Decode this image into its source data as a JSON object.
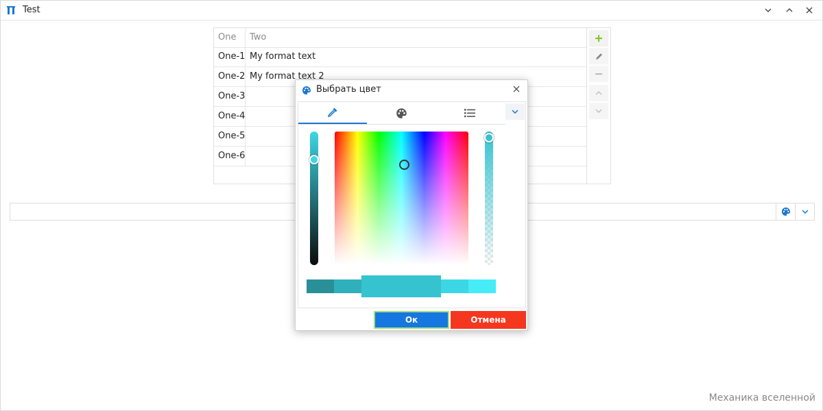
{
  "window": {
    "title": "Test"
  },
  "table": {
    "headers": [
      "One",
      "Two"
    ],
    "rows": [
      [
        "One-1",
        "My format text"
      ],
      [
        "One-2",
        "My format text 2"
      ],
      [
        "One-3",
        ""
      ],
      [
        "One-4",
        ""
      ],
      [
        "One-5",
        ""
      ],
      [
        "One-6",
        ""
      ]
    ]
  },
  "toolbar": {
    "icons": [
      "plus-icon",
      "pencil-icon",
      "minus-icon",
      "chevron-up-icon",
      "chevron-down-icon"
    ]
  },
  "color_field": {
    "value": "",
    "icons": [
      "palette-icon",
      "chevron-down-icon"
    ]
  },
  "footer": {
    "text": "Механика вселенной"
  },
  "dialog": {
    "title": "Выбрать цвет",
    "tabs": [
      "eyedropper-icon",
      "palette-icon",
      "list-icon"
    ],
    "current_color": "#36c3d0",
    "swatches": [
      "#2a9097",
      "#2fb0bb",
      "#36c3d0",
      "#3cd7e4",
      "#46ecf7"
    ],
    "ok_label": "Ок",
    "cancel_label": "Отмена"
  },
  "colors": {
    "accent": "#1677e0",
    "danger": "#f5371f",
    "add": "#7cc820"
  }
}
